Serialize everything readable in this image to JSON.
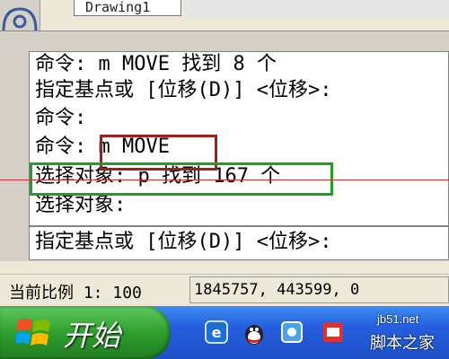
{
  "tabs": [
    {
      "label": "Drawing1"
    }
  ],
  "command_history": [
    {
      "text": "命令: m MOVE 找到 8 个"
    },
    {
      "text": "指定基点或 [位移(D)] <位移>:"
    },
    {
      "text": "命令:"
    },
    {
      "text": "命令: m MOVE"
    },
    {
      "text": "选择对象: p 找到 167 个"
    },
    {
      "text": "选择对象:"
    }
  ],
  "command_input": {
    "text": "指定基点或 [位移(D)] <位移>:"
  },
  "status": {
    "scale_label": "当前比例",
    "scale_value": "1: 100",
    "coordinates": "1845757, 443599, 0"
  },
  "taskbar": {
    "start_label": "开始"
  },
  "watermark": {
    "url": "jb51.net",
    "site": "脚本之家"
  },
  "colors": {
    "red_highlight": "#a02020",
    "green_highlight": "#20a020",
    "taskbar": "#245edc",
    "start": "#2f9f2f"
  }
}
